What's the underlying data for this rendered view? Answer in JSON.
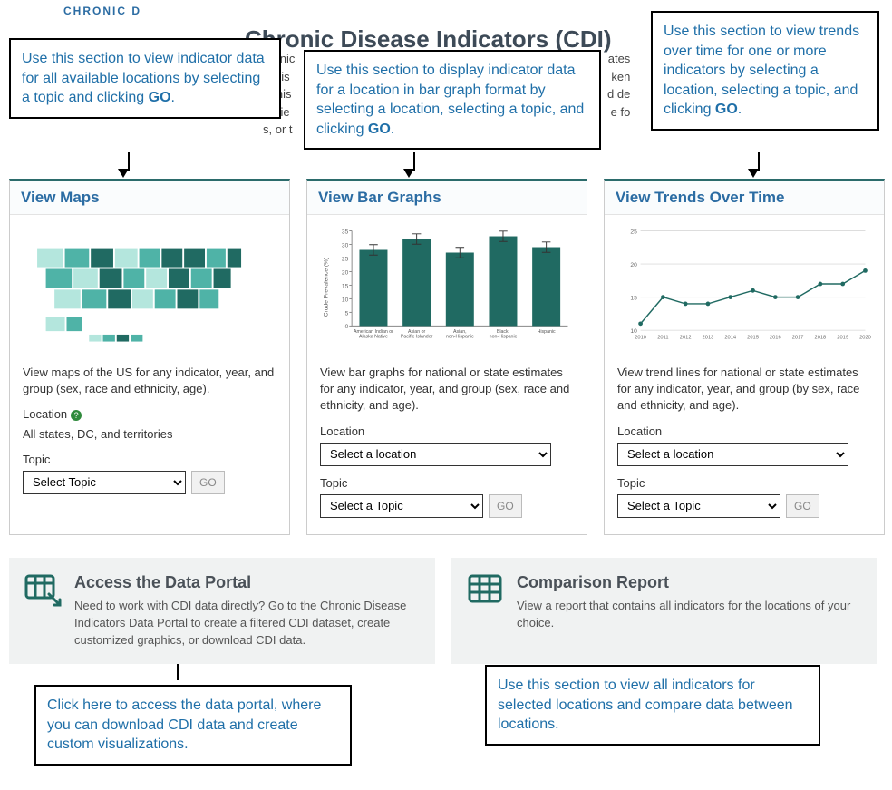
{
  "header": {
    "logo_text": "CHRONIC D",
    "title": "Chronic Disease Indicators (CDI)",
    "intro_lines": [
      "hronic",
      "ic dis",
      ". This",
      "olicie",
      "s, or t"
    ],
    "intro_right": [
      "ates",
      "ken",
      "d de",
      "e fo"
    ]
  },
  "callouts": {
    "maps": {
      "pre": "Use this section to view indicator data for all available locations by selecting a topic and clicking ",
      "bold": "GO",
      "post": "."
    },
    "bars": {
      "pre": "Use this section to display indicator data for a location in bar graph format by selecting a location, selecting a topic, and clicking ",
      "bold": "GO",
      "post": "."
    },
    "trends": {
      "pre": "Use this section to view trends over time for one or more indicators by selecting a location, selecting a topic, and clicking ",
      "bold": "GO",
      "post": "."
    },
    "portal": "Click here to access the data portal, where you can download CDI data and create custom visualizations.",
    "compare": "Use this section to view all indicators for selected locations and compare data between locations."
  },
  "cards": {
    "maps": {
      "title": "View Maps",
      "desc": "View maps of the US for any indicator, year, and group (sex, race and ethnicity, age).",
      "location_label": "Location",
      "location_value": "All states, DC, and territories",
      "topic_label": "Topic",
      "topic_placeholder": "Select Topic",
      "go_label": "GO"
    },
    "bars": {
      "title": "View Bar Graphs",
      "desc": "View bar graphs for national or state estimates for any indicator, year, and group (sex, race and ethnicity, and age).",
      "location_label": "Location",
      "location_placeholder": "Select a location",
      "topic_label": "Topic",
      "topic_placeholder": "Select a Topic",
      "go_label": "GO"
    },
    "trends": {
      "title": "View Trends Over Time",
      "desc": "View trend lines for national or state estimates for any indicator, year, and group (by sex, race and ethnicity, and age).",
      "location_label": "Location",
      "location_placeholder": "Select a location",
      "topic_label": "Topic",
      "topic_placeholder": "Select a Topic",
      "go_label": "GO"
    }
  },
  "bottom": {
    "portal": {
      "title": "Access the Data Portal",
      "desc": "Need to work with CDI data directly? Go to the Chronic Disease Indicators Data Portal to create a filtered CDI dataset, create customized graphics, or download CDI data."
    },
    "compare": {
      "title": "Comparison Report",
      "desc": "View a report that contains all indicators for the locations of your choice."
    }
  },
  "chart_data": [
    {
      "type": "bar",
      "categories": [
        "American Indian or Alaska Native",
        "Asian or Pacific Islander",
        "Asian, non-Hispanic",
        "Black, non-Hispanic",
        "Hispanic"
      ],
      "values": [
        28,
        32,
        27,
        33,
        29
      ],
      "title": "",
      "xlabel": "",
      "ylabel": "Crude Prevalence (%)",
      "ylim": [
        0,
        35
      ]
    },
    {
      "type": "line",
      "x": [
        2010,
        2011,
        2012,
        2013,
        2014,
        2015,
        2016,
        2017,
        2018,
        2019,
        2020
      ],
      "values": [
        11,
        15,
        14,
        14,
        15,
        16,
        15,
        15,
        17,
        17,
        19
      ],
      "title": "",
      "xlabel": "",
      "ylabel": "",
      "ylim": [
        10,
        25
      ]
    }
  ],
  "colors": {
    "teal_dark": "#206a62",
    "teal_mid": "#4fb3a7",
    "teal_light": "#b4e6dd",
    "link_blue": "#2b6ca3"
  }
}
